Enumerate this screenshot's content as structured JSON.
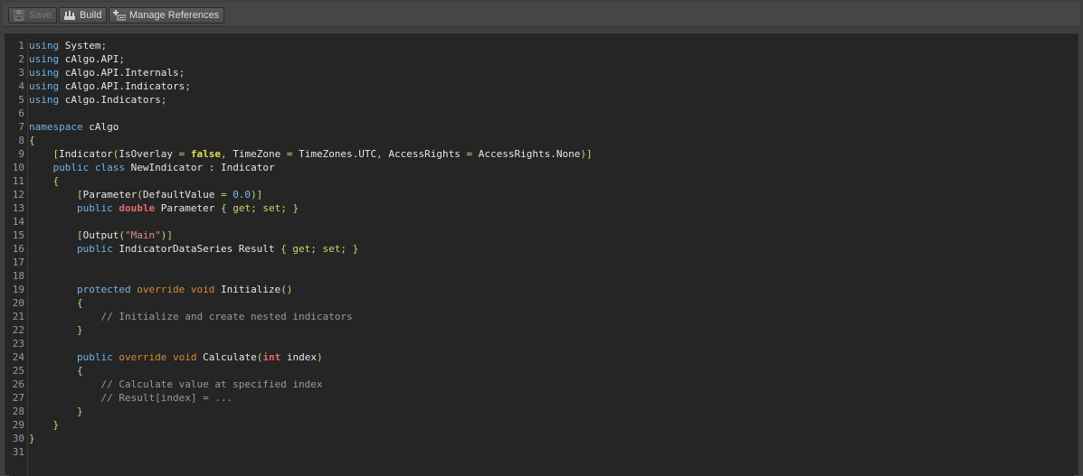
{
  "toolbar": {
    "buttons": [
      {
        "label": "Save",
        "icon": "save-icon",
        "enabled": false
      },
      {
        "label": "Build",
        "icon": "build-icon",
        "enabled": true
      },
      {
        "label": "Manage References",
        "icon": "references-icon",
        "enabled": true
      }
    ]
  },
  "colors": {
    "keyword": "#6fb3e8",
    "modifier": "#d58a36",
    "type": "#e36a6a",
    "plain": "#e6e6e6",
    "punct": "#c8d96a",
    "number": "#7fb5f0",
    "string": "#e68a8a",
    "comment": "#9a9a9a",
    "bool": "#e2e24c"
  },
  "editor": {
    "lines": [
      [
        [
          "kw",
          "using"
        ],
        [
          "pl",
          " System"
        ],
        [
          "op",
          ";"
        ]
      ],
      [
        [
          "kw",
          "using"
        ],
        [
          "pl",
          " cAlgo.API"
        ],
        [
          "op",
          ";"
        ]
      ],
      [
        [
          "kw",
          "using"
        ],
        [
          "pl",
          " cAlgo.API.Internals"
        ],
        [
          "op",
          ";"
        ]
      ],
      [
        [
          "kw",
          "using"
        ],
        [
          "pl",
          " cAlgo.API.Indicators"
        ],
        [
          "op",
          ";"
        ]
      ],
      [
        [
          "kw",
          "using"
        ],
        [
          "pl",
          " cAlgo.Indicators"
        ],
        [
          "op",
          ";"
        ]
      ],
      [],
      [
        [
          "kw",
          "namespace"
        ],
        [
          "pl",
          " cAlgo"
        ]
      ],
      [
        [
          "op",
          "{"
        ]
      ],
      [
        [
          "pl",
          "    "
        ],
        [
          "op",
          "["
        ],
        [
          "pl",
          "Indicator"
        ],
        [
          "op",
          "("
        ],
        [
          "pl",
          "IsOverlay "
        ],
        [
          "op",
          "="
        ],
        [
          "pl",
          " "
        ],
        [
          "bool",
          "false"
        ],
        [
          "op",
          ","
        ],
        [
          "pl",
          " TimeZone "
        ],
        [
          "op",
          "="
        ],
        [
          "pl",
          " TimeZones.UTC"
        ],
        [
          "op",
          ","
        ],
        [
          "pl",
          " AccessRights "
        ],
        [
          "op",
          "="
        ],
        [
          "pl",
          " AccessRights.None"
        ],
        [
          "op",
          ")]"
        ]
      ],
      [
        [
          "pl",
          "    "
        ],
        [
          "kw",
          "public"
        ],
        [
          "pl",
          " "
        ],
        [
          "kw",
          "class"
        ],
        [
          "pl",
          " NewIndicator : Indicator"
        ]
      ],
      [
        [
          "pl",
          "    "
        ],
        [
          "op",
          "{"
        ]
      ],
      [
        [
          "pl",
          "        "
        ],
        [
          "op",
          "["
        ],
        [
          "pl",
          "Parameter"
        ],
        [
          "op",
          "("
        ],
        [
          "pl",
          "DefaultValue "
        ],
        [
          "op",
          "="
        ],
        [
          "pl",
          " "
        ],
        [
          "num",
          "0.0"
        ],
        [
          "op",
          ")]"
        ]
      ],
      [
        [
          "pl",
          "        "
        ],
        [
          "kw",
          "public"
        ],
        [
          "pl",
          " "
        ],
        [
          "ty",
          "double"
        ],
        [
          "pl",
          " Parameter "
        ],
        [
          "op",
          "{"
        ],
        [
          "pl",
          " "
        ],
        [
          "op",
          "get;"
        ],
        [
          "pl",
          " "
        ],
        [
          "op",
          "set;"
        ],
        [
          "pl",
          " "
        ],
        [
          "op",
          "}"
        ]
      ],
      [],
      [
        [
          "pl",
          "        "
        ],
        [
          "op",
          "["
        ],
        [
          "pl",
          "Output"
        ],
        [
          "op",
          "("
        ],
        [
          "str",
          "\"Main\""
        ],
        [
          "op",
          ")]"
        ]
      ],
      [
        [
          "pl",
          "        "
        ],
        [
          "kw",
          "public"
        ],
        [
          "pl",
          " IndicatorDataSeries Result "
        ],
        [
          "op",
          "{"
        ],
        [
          "pl",
          " "
        ],
        [
          "op",
          "get;"
        ],
        [
          "pl",
          " "
        ],
        [
          "op",
          "set;"
        ],
        [
          "pl",
          " "
        ],
        [
          "op",
          "}"
        ]
      ],
      [],
      [],
      [
        [
          "pl",
          "        "
        ],
        [
          "kw",
          "protected"
        ],
        [
          "pl",
          " "
        ],
        [
          "kw2",
          "override"
        ],
        [
          "pl",
          " "
        ],
        [
          "kw2",
          "void"
        ],
        [
          "pl",
          " Initialize"
        ],
        [
          "op",
          "()"
        ]
      ],
      [
        [
          "pl",
          "        "
        ],
        [
          "op",
          "{"
        ]
      ],
      [
        [
          "pl",
          "            "
        ],
        [
          "cm",
          "// Initialize and create nested indicators"
        ]
      ],
      [
        [
          "pl",
          "        "
        ],
        [
          "op",
          "}"
        ]
      ],
      [],
      [
        [
          "pl",
          "        "
        ],
        [
          "kw",
          "public"
        ],
        [
          "pl",
          " "
        ],
        [
          "kw2",
          "override"
        ],
        [
          "pl",
          " "
        ],
        [
          "kw2",
          "void"
        ],
        [
          "pl",
          " Calculate"
        ],
        [
          "op",
          "("
        ],
        [
          "ty",
          "int"
        ],
        [
          "pl",
          " index"
        ],
        [
          "op",
          ")"
        ]
      ],
      [
        [
          "pl",
          "        "
        ],
        [
          "op",
          "{"
        ]
      ],
      [
        [
          "pl",
          "            "
        ],
        [
          "cm",
          "// Calculate value at specified index"
        ]
      ],
      [
        [
          "pl",
          "            "
        ],
        [
          "cm",
          "// Result[index] = ..."
        ]
      ],
      [
        [
          "pl",
          "        "
        ],
        [
          "op",
          "}"
        ]
      ],
      [
        [
          "pl",
          "    "
        ],
        [
          "op",
          "}"
        ]
      ],
      [
        [
          "op",
          "}"
        ]
      ],
      []
    ]
  }
}
